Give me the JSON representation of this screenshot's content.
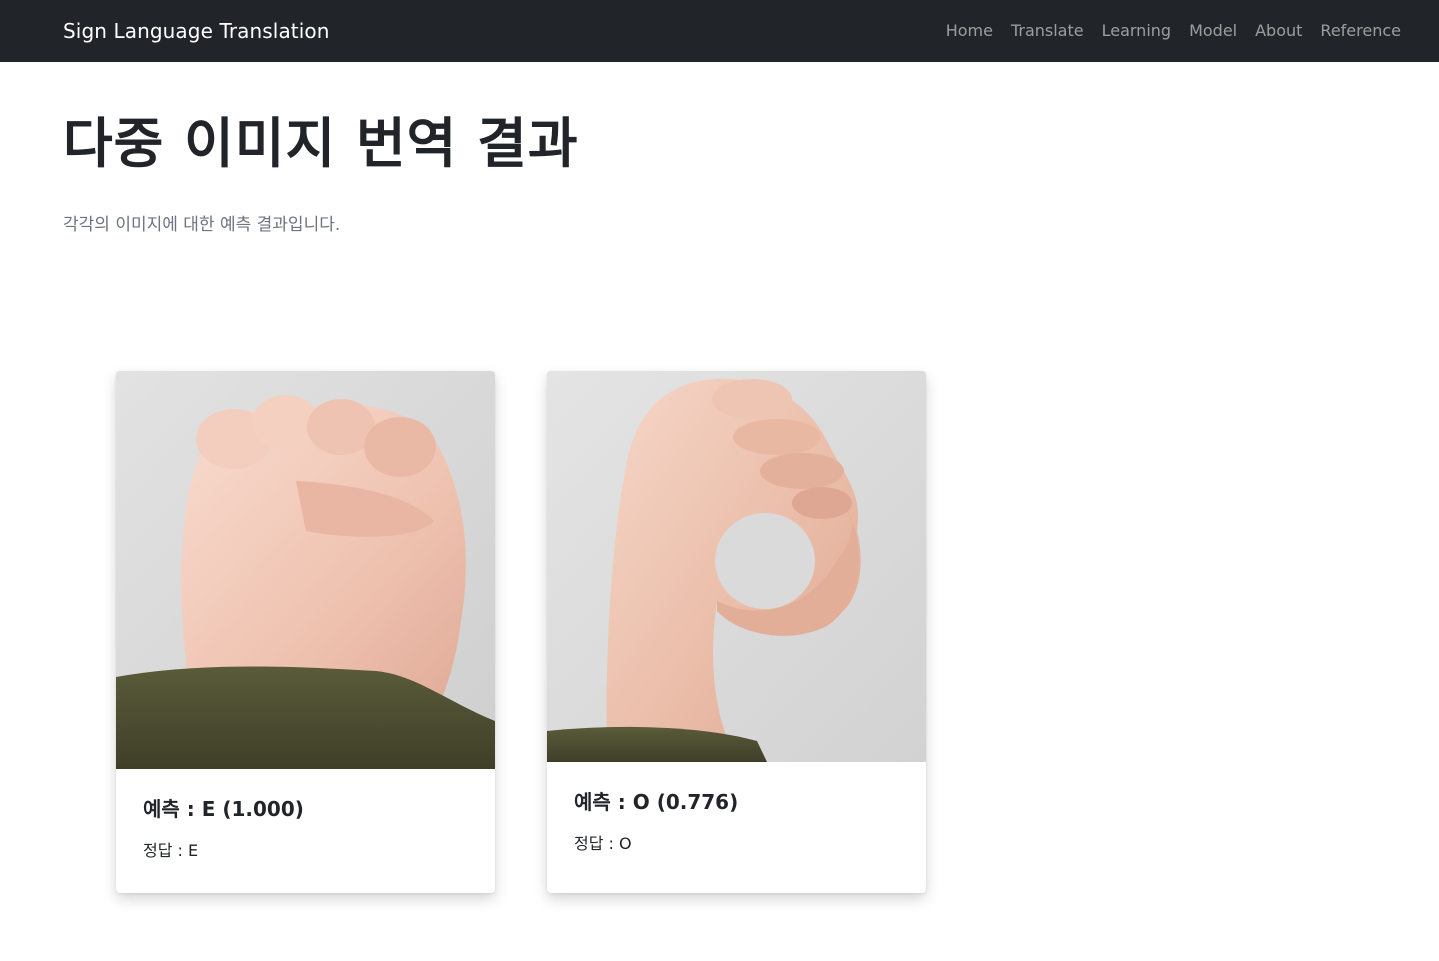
{
  "navbar": {
    "brand": "Sign Language Translation",
    "links": [
      "Home",
      "Translate",
      "Learning",
      "Model",
      "About",
      "Reference"
    ]
  },
  "header": {
    "title": "다중 이미지 번역 결과",
    "subtitle": "각각의 이미지에 대한 예측 결과입니다."
  },
  "results": [
    {
      "prediction": "예측 : E (1.000)",
      "answer": "정답 : E"
    },
    {
      "prediction": "예측 : O (0.776)",
      "answer": "정답 : O"
    }
  ],
  "colors": {
    "navbar_bg": "#212529",
    "brand_text": "#ffffff",
    "nav_link": "#9a9da0",
    "lead_text": "#6c757d",
    "skin": "#f0c8b8",
    "sleeve": "#4f5032"
  }
}
